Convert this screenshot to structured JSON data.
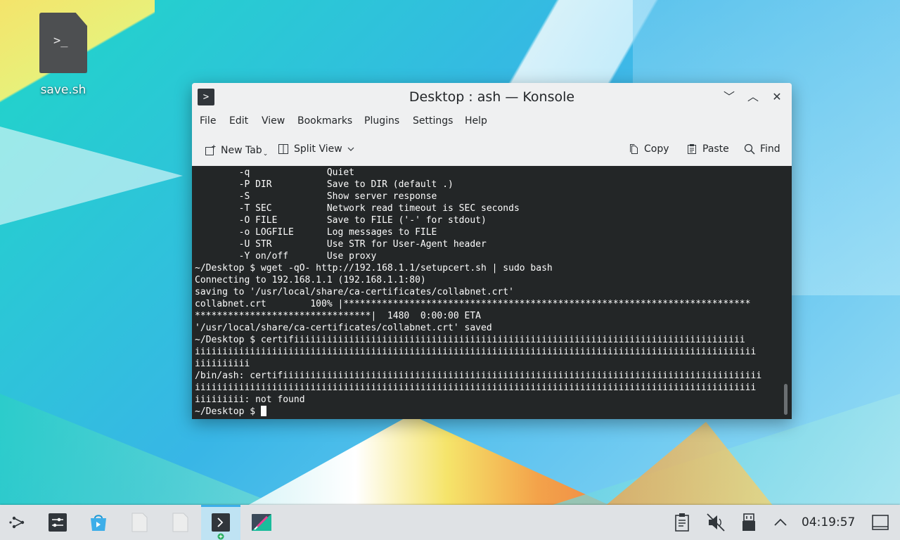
{
  "desktop": {
    "icon_label": "save.sh",
    "icon_glyph": ">_"
  },
  "window": {
    "title": "Desktop : ash — Konsole",
    "app_glyph": ">",
    "controls": {
      "minimize": "﹀",
      "maximize": "︿",
      "close": "✕"
    }
  },
  "menubar": {
    "items": [
      "File",
      "Edit",
      "View",
      "Bookmarks",
      "Plugins",
      "Settings",
      "Help"
    ]
  },
  "toolbar": {
    "new_tab": "New Tab",
    "split_view": "Split View",
    "copy": "Copy",
    "paste": "Paste",
    "find": "Find"
  },
  "terminal": {
    "lines": [
      "        -q              Quiet",
      "        -P DIR          Save to DIR (default .)",
      "        -S              Show server response",
      "        -T SEC          Network read timeout is SEC seconds",
      "        -O FILE         Save to FILE ('-' for stdout)",
      "        -o LOGFILE      Log messages to FILE",
      "        -U STR          Use STR for User-Agent header",
      "        -Y on/off       Use proxy",
      "~/Desktop $ wget -qO- http://192.168.1.1/setupcert.sh | sudo bash",
      "Connecting to 192.168.1.1 (192.168.1.1:80)",
      "saving to '/usr/local/share/ca-certificates/collabnet.crt'",
      "collabnet.crt        100% |**************************************************************************",
      "********************************|  1480  0:00:00 ETA",
      "'/usr/local/share/ca-certificates/collabnet.crt' saved",
      "~/Desktop $ certifiiiiiiiiiiiiiiiiiiiiiiiiiiiiiiiiiiiiiiiiiiiiiiiiiiiiiiiiiiiiiiiiiiiiiiiiiiiiiiiiii",
      "iiiiiiiiiiiiiiiiiiiiiiiiiiiiiiiiiiiiiiiiiiiiiiiiiiiiiiiiiiiiiiiiiiiiiiiiiiiiiiiiiiiiiiiiiiiiiiiiiiiiii",
      "iiiiiiiiii",
      "/bin/ash: certifiiiiiiiiiiiiiiiiiiiiiiiiiiiiiiiiiiiiiiiiiiiiiiiiiiiiiiiiiiiiiiiiiiiiiiiiiiiiiiiiiiiiiii",
      "iiiiiiiiiiiiiiiiiiiiiiiiiiiiiiiiiiiiiiiiiiiiiiiiiiiiiiiiiiiiiiiiiiiiiiiiiiiiiiiiiiiiiiiiiiiiiiiiiiiiii",
      "iiiiiiiii: not found"
    ],
    "prompt": "~/Desktop $ "
  },
  "taskbar": {
    "clock": "04:19:57"
  },
  "colors": {
    "accent": "#3daee9",
    "terminal_bg": "#232627",
    "terminal_fg": "#fcfcfc"
  }
}
